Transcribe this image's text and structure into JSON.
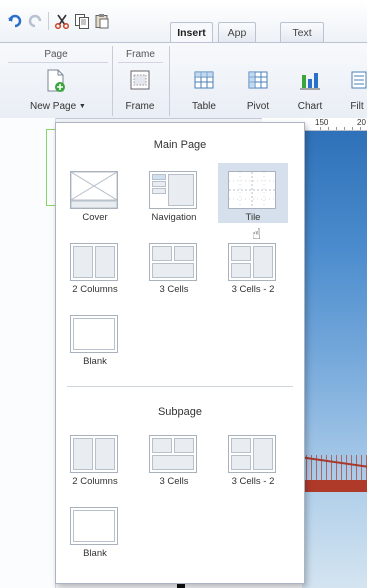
{
  "tabs": [
    {
      "label": "Insert",
      "active": true
    },
    {
      "label": "App",
      "active": false
    },
    {
      "label": "Text",
      "active": false
    }
  ],
  "ribbon": {
    "groups": {
      "page": "Page",
      "frame": "Frame"
    },
    "buttons": {
      "new_page": "New Page",
      "frame": "Frame",
      "table": "Table",
      "pivot": "Pivot",
      "chart": "Chart",
      "filter": "Filt"
    }
  },
  "ruler": {
    "mark1": "150",
    "mark2": "20"
  },
  "panel": {
    "main_title": "Main Page",
    "sub_title": "Subpage",
    "main_layouts": [
      "Cover",
      "Navigation",
      "Tile",
      "2 Columns",
      "3 Cells",
      "3 Cells - 2",
      "Blank"
    ],
    "sub_layouts": [
      "2 Columns",
      "3 Cells",
      "3 Cells - 2",
      "Blank"
    ],
    "selected": "Tile"
  },
  "colors": {
    "accent": "#d6e0ec",
    "tab_border": "#b9c3d2",
    "green_frame": "#8cd36a"
  }
}
